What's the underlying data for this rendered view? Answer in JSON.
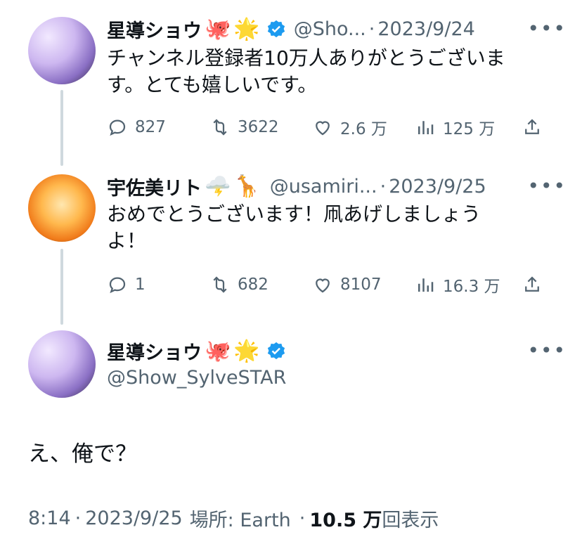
{
  "tweets": [
    {
      "name": "星導ショウ",
      "emoji1": "🐙",
      "emoji2": "🌟",
      "handle": "@Sho...",
      "date": "2023/9/24",
      "text_line1": "チャンネル登録者10万人ありがとうございま",
      "text_line2": "す。とても嬉しいです。",
      "replies": "827",
      "retweets": "3622",
      "likes": "2.6 万",
      "views": "125 万"
    },
    {
      "name": "宇佐美リト",
      "emoji1": "🌩️",
      "emoji2": "🦒",
      "handle": "@usamiri...",
      "date": "2023/9/25",
      "text_line1": "おめでとうございます！凧あげしましょう",
      "text_line2": "よ！",
      "replies": "1",
      "retweets": "682",
      "likes": "8107",
      "views": "16.3 万"
    }
  ],
  "main_tweet": {
    "name": "星導ショウ",
    "emoji1": "🐙",
    "emoji2": "🌟",
    "handle": "@Show_SylveSTAR",
    "text": "え、俺で？",
    "time": "8:14",
    "date": "2023/9/25",
    "location": "場所: Earth",
    "view_count": "10.5 万",
    "view_label": "回表示"
  },
  "separator": "·",
  "more_label": "•••",
  "colors": {
    "verified": "#1d9bf0",
    "secondary": "#536471",
    "thread": "#cfd9de"
  },
  "icons": [
    "reply-icon",
    "retweet-icon",
    "like-icon",
    "views-icon",
    "share-icon",
    "verified-badge-icon",
    "more-icon"
  ]
}
